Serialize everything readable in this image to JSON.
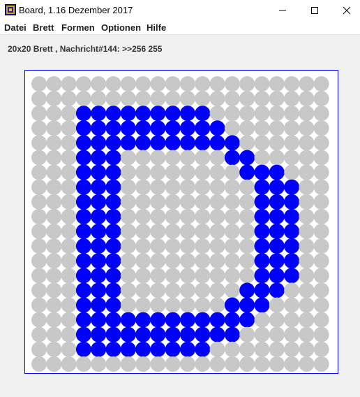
{
  "window": {
    "title": "Board, 1.16 Dezember 2017",
    "icon": "board-grid-icon",
    "controls": [
      "minimize-icon",
      "maximize-icon",
      "close-icon"
    ]
  },
  "menu": {
    "items": [
      "Datei",
      "Brett",
      "Formen",
      "Optionen",
      "Hilfe"
    ]
  },
  "status": {
    "message": "20x20 Brett , Nachricht#144: >>256 255"
  },
  "board": {
    "columns": 20,
    "rows": 20,
    "colors": {
      "border": "#0000ff",
      "background": "#ffffff",
      "empty": "#c8c8c8",
      "filled": "#0000ff"
    },
    "filled_cells": [
      [
        3,
        2
      ],
      [
        4,
        2
      ],
      [
        5,
        2
      ],
      [
        6,
        2
      ],
      [
        7,
        2
      ],
      [
        8,
        2
      ],
      [
        9,
        2
      ],
      [
        10,
        2
      ],
      [
        11,
        2
      ],
      [
        3,
        3
      ],
      [
        4,
        3
      ],
      [
        5,
        3
      ],
      [
        6,
        3
      ],
      [
        7,
        3
      ],
      [
        8,
        3
      ],
      [
        9,
        3
      ],
      [
        10,
        3
      ],
      [
        11,
        3
      ],
      [
        12,
        3
      ],
      [
        3,
        4
      ],
      [
        4,
        4
      ],
      [
        5,
        4
      ],
      [
        6,
        4
      ],
      [
        7,
        4
      ],
      [
        8,
        4
      ],
      [
        9,
        4
      ],
      [
        10,
        4
      ],
      [
        11,
        4
      ],
      [
        12,
        4
      ],
      [
        13,
        4
      ],
      [
        3,
        5
      ],
      [
        4,
        5
      ],
      [
        5,
        5
      ],
      [
        13,
        5
      ],
      [
        14,
        5
      ],
      [
        3,
        6
      ],
      [
        4,
        6
      ],
      [
        5,
        6
      ],
      [
        14,
        6
      ],
      [
        15,
        6
      ],
      [
        16,
        6
      ],
      [
        3,
        7
      ],
      [
        4,
        7
      ],
      [
        5,
        7
      ],
      [
        15,
        7
      ],
      [
        16,
        7
      ],
      [
        17,
        7
      ],
      [
        3,
        8
      ],
      [
        4,
        8
      ],
      [
        5,
        8
      ],
      [
        15,
        8
      ],
      [
        16,
        8
      ],
      [
        17,
        8
      ],
      [
        3,
        9
      ],
      [
        4,
        9
      ],
      [
        5,
        9
      ],
      [
        15,
        9
      ],
      [
        16,
        9
      ],
      [
        17,
        9
      ],
      [
        3,
        10
      ],
      [
        4,
        10
      ],
      [
        5,
        10
      ],
      [
        15,
        10
      ],
      [
        16,
        10
      ],
      [
        17,
        10
      ],
      [
        3,
        11
      ],
      [
        4,
        11
      ],
      [
        5,
        11
      ],
      [
        15,
        11
      ],
      [
        16,
        11
      ],
      [
        17,
        11
      ],
      [
        3,
        12
      ],
      [
        4,
        12
      ],
      [
        5,
        12
      ],
      [
        15,
        12
      ],
      [
        16,
        12
      ],
      [
        17,
        12
      ],
      [
        3,
        13
      ],
      [
        4,
        13
      ],
      [
        5,
        13
      ],
      [
        15,
        13
      ],
      [
        16,
        13
      ],
      [
        17,
        13
      ],
      [
        3,
        14
      ],
      [
        4,
        14
      ],
      [
        5,
        14
      ],
      [
        14,
        14
      ],
      [
        15,
        14
      ],
      [
        16,
        14
      ],
      [
        3,
        15
      ],
      [
        4,
        15
      ],
      [
        5,
        15
      ],
      [
        13,
        15
      ],
      [
        14,
        15
      ],
      [
        15,
        15
      ],
      [
        3,
        16
      ],
      [
        4,
        16
      ],
      [
        5,
        16
      ],
      [
        6,
        16
      ],
      [
        7,
        16
      ],
      [
        8,
        16
      ],
      [
        9,
        16
      ],
      [
        10,
        16
      ],
      [
        11,
        16
      ],
      [
        12,
        16
      ],
      [
        13,
        16
      ],
      [
        14,
        16
      ],
      [
        3,
        17
      ],
      [
        4,
        17
      ],
      [
        5,
        17
      ],
      [
        6,
        17
      ],
      [
        7,
        17
      ],
      [
        8,
        17
      ],
      [
        9,
        17
      ],
      [
        10,
        17
      ],
      [
        11,
        17
      ],
      [
        12,
        17
      ],
      [
        13,
        17
      ],
      [
        3,
        18
      ],
      [
        4,
        18
      ],
      [
        5,
        18
      ],
      [
        6,
        18
      ],
      [
        7,
        18
      ],
      [
        8,
        18
      ],
      [
        9,
        18
      ],
      [
        10,
        18
      ],
      [
        11,
        18
      ]
    ]
  }
}
